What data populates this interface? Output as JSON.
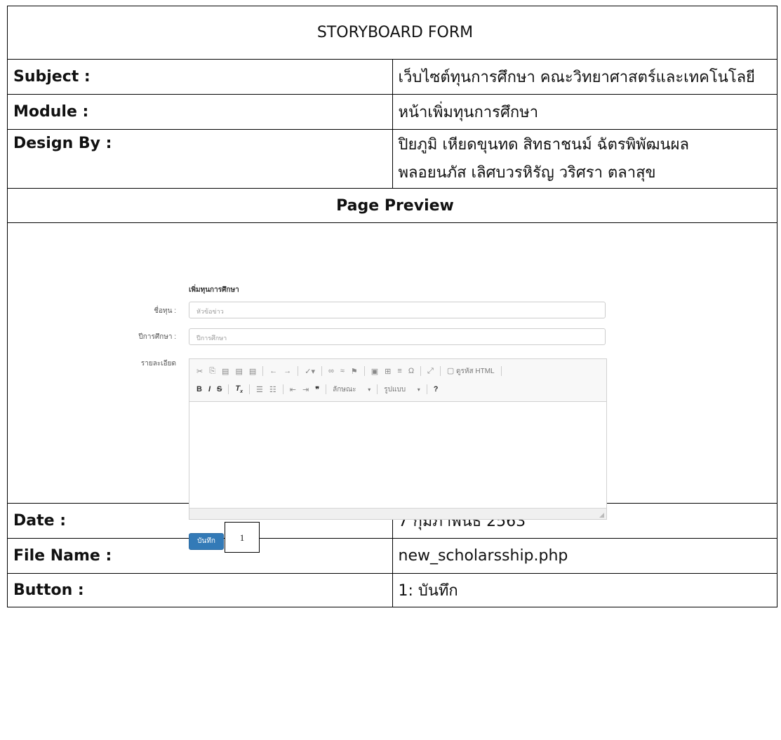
{
  "header": {
    "title": "STORYBOARD FORM"
  },
  "rows": {
    "subject": {
      "label": "Subject  :",
      "value": "เว็บไซต์ทุนการศึกษา คณะวิทยาศาสตร์และเทคโนโลยี"
    },
    "module": {
      "label": "Module :",
      "value": "หน้าเพิ่มทุนการศึกษา"
    },
    "design_by": {
      "label": "Design By  :",
      "value_line1": "ปิยภูมิ เหียดขุนทด  สิทธาชนม์ ฉัตรพิพัฒนผล",
      "value_line2": "พลอยนภัส เลิศบวรหิรัญ  วริศรา ตลาสุข"
    },
    "date": {
      "label": "Date  :",
      "value": "7 กุมภาพันธ์ 2563"
    },
    "file_name": {
      "label": "File Name  :",
      "value": "new_scholarsship.php"
    },
    "button": {
      "label": "Button  :",
      "value": "1: บันทึก"
    }
  },
  "preview": {
    "section_title": "Page Preview",
    "form_title": "เพิ่มทุนการศึกษา",
    "fields": [
      {
        "label": "ชื่อทุน :",
        "placeholder": "หัวข้อข่าว"
      },
      {
        "label": "ปีการศึกษา :",
        "placeholder": "ปีการศึกษา"
      }
    ],
    "detail_label": "รายละเอียด",
    "toolbar": {
      "source_label": "ดูรหัส HTML",
      "format_label": "ลักษณะ",
      "style_label": "รูปแบบ",
      "help_label": "?"
    },
    "save_button": "บันทึก",
    "callout_number": "1"
  }
}
